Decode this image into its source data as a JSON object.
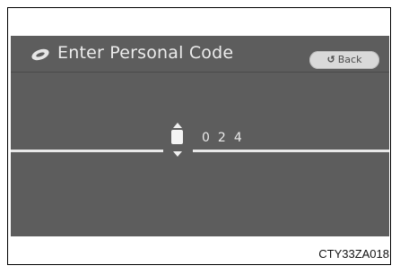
{
  "screen": {
    "title": "Enter Personal Code",
    "title_icon": "key-icon",
    "back_button": {
      "label": "Back",
      "icon": "return-arrow-icon"
    },
    "code_entry": {
      "digits": [
        "0",
        "2",
        "4"
      ]
    }
  },
  "figure_code": "CTY33ZA018",
  "colors": {
    "screen_bg": "#5d5d5d",
    "text": "#ececec",
    "button_bg": "#d9d9d9"
  }
}
